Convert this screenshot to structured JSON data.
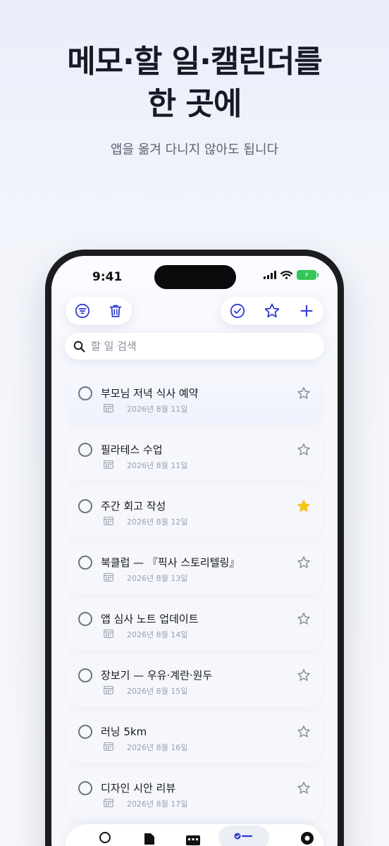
{
  "hero": {
    "line1": "메모·할 일·캘린더를",
    "line2": "한 곳에",
    "subtitle": "앱을 옮겨 다니지 않아도 됩니다"
  },
  "status_bar": {
    "time": "9:41",
    "battery": "⚡"
  },
  "toolbar": {
    "left_icons": [
      "filter-icon",
      "trash-icon"
    ],
    "right_icons": [
      "check-circle-icon",
      "star-outline-icon",
      "plus-icon"
    ]
  },
  "search": {
    "placeholder": "할 일 검색",
    "value": ""
  },
  "tasks": [
    {
      "title": "부모님 저녁 식사 예약",
      "date": "2026년 8월 11일",
      "starred": false
    },
    {
      "title": "필라테스 수업",
      "date": "2026년 8월 11일",
      "starred": false
    },
    {
      "title": "주간 회고 작성",
      "date": "2026년 8월 12일",
      "starred": true
    },
    {
      "title": "북클럽 — 『픽사 스토리텔링』",
      "date": "2026년 8월 13일",
      "starred": false
    },
    {
      "title": "앱 심사 노트 업데이트",
      "date": "2026년 8월 14일",
      "starred": false
    },
    {
      "title": "장보기 — 우유·계란·원두",
      "date": "2026년 8월 15일",
      "starred": false
    },
    {
      "title": "러닝 5km",
      "date": "2026년 8월 16일",
      "starred": false
    },
    {
      "title": "디자인 시안 리뷰",
      "date": "2026년 8월 17일",
      "starred": false
    }
  ],
  "tab_bar": {
    "tabs": [
      "search-tab-icon",
      "document-tab-icon",
      "calendar-tab-icon",
      "tasks-tab-icon",
      "settings-tab-icon"
    ],
    "active": "tasks-tab-icon"
  },
  "colors": {
    "accent": "#2f3bd1",
    "star_active": "#f5c518",
    "battery": "#34c759",
    "headline": "#161a26"
  }
}
